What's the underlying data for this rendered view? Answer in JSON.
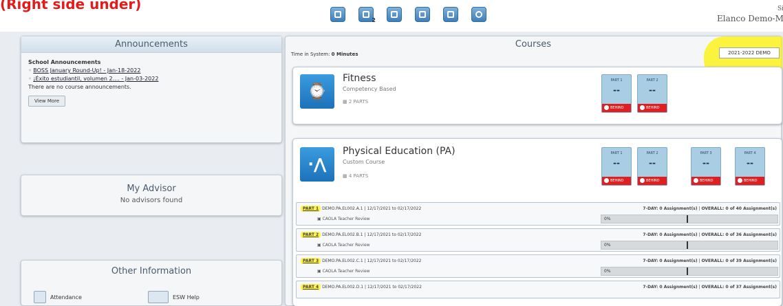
{
  "header": {
    "red_title": "(Right side under)",
    "user_name": "Elanco Demo-M",
    "user_corner": "Si",
    "toolbar": [
      {
        "icon": "home-icon",
        "count": ""
      },
      {
        "icon": "transcript-icon",
        "count": "2"
      },
      {
        "icon": "mail-icon",
        "count": ""
      },
      {
        "icon": "chart-icon",
        "count": ""
      },
      {
        "icon": "calendar-icon",
        "count": ""
      },
      {
        "icon": "help-icon",
        "count": ""
      }
    ]
  },
  "announcements": {
    "title": "Announcements",
    "heading": "School Announcements",
    "items": [
      "BOSS January Round-Up! - Jan-18-2022",
      "¡Éxito estudiantil, volumen 2.... - Jan-03-2022"
    ],
    "no_course": "There are no course announcements.",
    "view_more": "View More"
  },
  "advisor": {
    "title": "My Advisor",
    "text": "No advisors found"
  },
  "other": {
    "title": "Other Information",
    "items": [
      "Attendance",
      "ESW Help"
    ]
  },
  "courses": {
    "title": "Courses",
    "time_label": "Time in System:",
    "time_value": "0 Minutes",
    "year": "2021-2022 DEMO",
    "list": [
      {
        "name": "Fitness",
        "type": "Competency Based",
        "parts_label": "2 PARTS",
        "parts": [
          {
            "label": "PART 1",
            "grade": "--",
            "status": "BEHIND"
          },
          {
            "label": "PART 2",
            "grade": "--",
            "status": "BEHIND"
          }
        ]
      },
      {
        "name": "Physical Education (PA)",
        "type": "Custom Course",
        "parts_label": "4 PARTS",
        "parts": [
          {
            "label": "PART 1",
            "grade": "--",
            "status": "BEHIND"
          },
          {
            "label": "PART 2",
            "grade": "--",
            "status": "BEHIND"
          },
          {
            "label": "PART 3",
            "grade": "--",
            "status": "BEHIND"
          },
          {
            "label": "PART 4",
            "grade": "--",
            "status": "BEHIND"
          }
        ]
      }
    ],
    "rows": [
      {
        "part": "PART 1",
        "code": "DEMO.PA.EL002.A.1",
        "dates": "12/17/2021 to 02/17/2022",
        "reviewer": "CAOLA Teacher Review",
        "seven_day": "7-DAY: 0 Assignment(s)",
        "overall": "OVERALL: 0 of 40 Assignment(s)",
        "progress": "0%"
      },
      {
        "part": "PART 2",
        "code": "DEMO.PA.EL002.B.1",
        "dates": "12/17/2021 to 02/17/2022",
        "reviewer": "CAOLA Teacher Review",
        "seven_day": "7-DAY: 0 Assignment(s)",
        "overall": "OVERALL: 0 of 36 Assignment(s)",
        "progress": "0%"
      },
      {
        "part": "PART 3",
        "code": "DEMO.PA.EL002.C.1",
        "dates": "12/17/2021 to 02/17/2022",
        "reviewer": "CAOLA Teacher Review",
        "seven_day": "7-DAY: 0 Assignment(s)",
        "overall": "OVERALL: 0 of 39 Assignment(s)",
        "progress": "0%"
      },
      {
        "part": "PART 4",
        "code": "DEMO.PA.EL002.D.1",
        "dates": "12/17/2021 to 02/17/2022",
        "reviewer": "",
        "seven_day": "7-DAY: 0 Assignment(s)",
        "overall": "OVERALL: 0 of 37 Assignment(s)",
        "progress": ""
      }
    ]
  }
}
